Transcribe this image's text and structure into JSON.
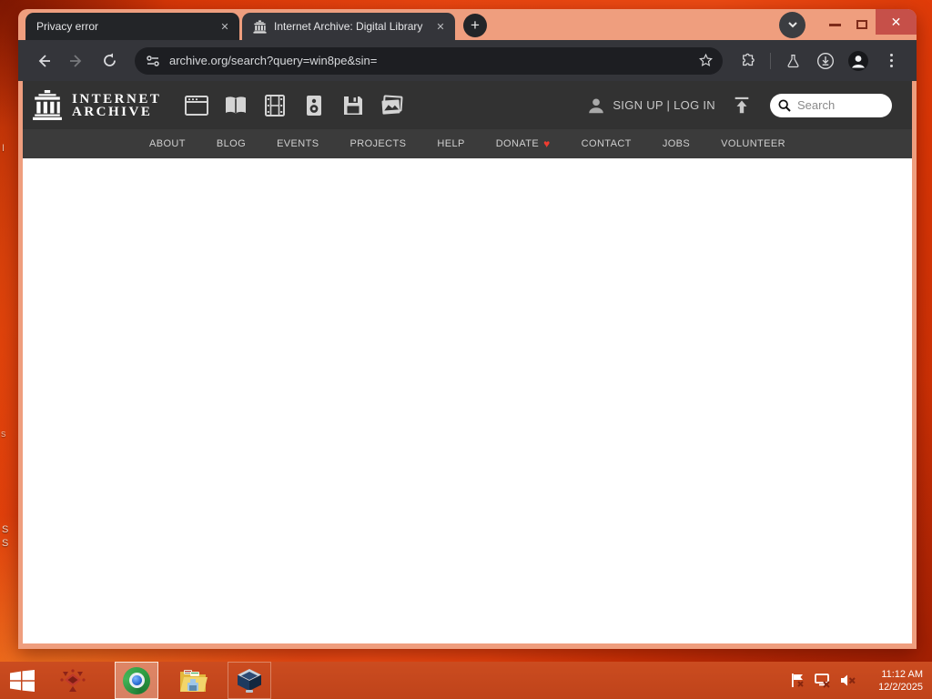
{
  "browser": {
    "tabs": [
      {
        "title": "Privacy error"
      },
      {
        "title": "Internet Archive: Digital Library"
      }
    ],
    "new_tab_glyph": "+",
    "close_glyph": "✕",
    "url": "archive.org/search?query=win8pe&sin="
  },
  "ia": {
    "wordmark_line1": "INTERNET",
    "wordmark_line2": "ARCHIVE",
    "auth_label": "SIGN UP | LOG IN",
    "search_placeholder": "Search",
    "nav": [
      "ABOUT",
      "BLOG",
      "EVENTS",
      "PROJECTS",
      "HELP",
      "DONATE",
      "CONTACT",
      "JOBS",
      "VOLUNTEER"
    ],
    "heart_glyph": "♥"
  },
  "taskbar": {
    "time": "11:12 AM",
    "date": "12/2/2025"
  },
  "desktop": {
    "fragments": [
      "I",
      "s",
      "S",
      "S"
    ]
  },
  "colors": {
    "frame_salmon": "#ef9e7e",
    "desktop_orange": "#ea4510",
    "close_button_red": "#c65049",
    "heart_red": "#f03c30",
    "dark_ui": "#34353a",
    "ia_header": "#323232"
  }
}
